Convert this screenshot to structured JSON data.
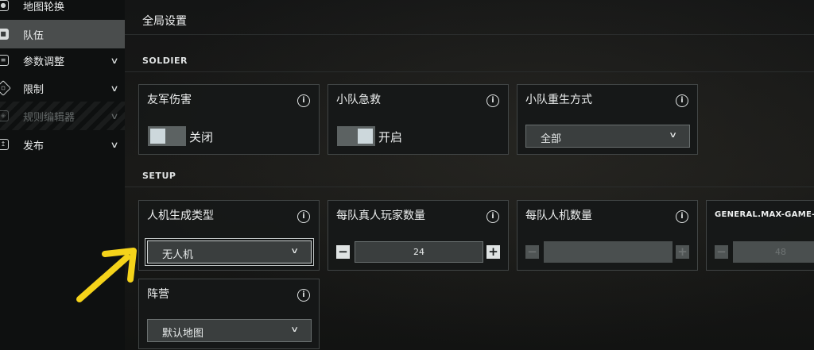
{
  "sidebar": {
    "items": [
      {
        "label": "地图轮换",
        "icon": "map-pin-icon",
        "state": "normal",
        "chevron": ""
      },
      {
        "label": "队伍",
        "icon": "team-icon",
        "state": "active",
        "chevron": ""
      },
      {
        "label": "参数调整",
        "icon": "sliders-icon",
        "state": "normal",
        "chevron": "∨"
      },
      {
        "label": "限制",
        "icon": "restrict-icon",
        "state": "normal",
        "chevron": "∨"
      },
      {
        "label": "规则编辑器",
        "icon": "rules-icon",
        "state": "disabled",
        "chevron": "∨"
      },
      {
        "label": "发布",
        "icon": "publish-icon",
        "state": "normal",
        "chevron": "∨"
      }
    ]
  },
  "main": {
    "title": "全局设置",
    "sections": {
      "soldier": "SOLDIER",
      "setup": "SETUP"
    },
    "cards": {
      "friendly_fire": {
        "label": "友军伤害",
        "state": "关闭",
        "on": false
      },
      "squad_revive": {
        "label": "小队急救",
        "state": "开启",
        "on": true
      },
      "squad_respawn": {
        "label": "小队重生方式",
        "value": "全部"
      },
      "ai_spawn_type": {
        "label": "人机生成类型",
        "value": "无人机"
      },
      "human_players": {
        "label": "每队真人玩家数量",
        "value": "24"
      },
      "ai_per_team": {
        "label": "每队人机数量",
        "value": ""
      },
      "max_game": {
        "label": "GENERAL.MAX-GAME-",
        "value": "48"
      },
      "faction": {
        "label": "阵营",
        "value": "默认地图"
      }
    },
    "info_glyph": "i",
    "minus_glyph": "−",
    "plus_glyph": "+",
    "chevron_glyph": "∨"
  },
  "colors": {
    "annotation_arrow": "#f5d31a",
    "active_nav": "#4a4d4d",
    "card_border": "#414545"
  }
}
